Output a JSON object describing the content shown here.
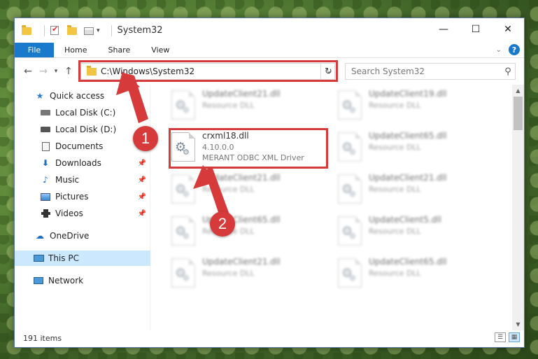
{
  "title_bar": {
    "title": "System32",
    "minimize": "—",
    "maximize": "☐",
    "close": "✕"
  },
  "ribbon": {
    "tabs": [
      "File",
      "Home",
      "Share",
      "View"
    ],
    "help": "?"
  },
  "address": {
    "path": "C:\\Windows\\System32",
    "search_placeholder": "Search System32"
  },
  "sidebar": {
    "items": [
      {
        "label": "Quick access",
        "icon": "star-icon",
        "pinned": false
      },
      {
        "label": "Local Disk (C:)",
        "icon": "drive-icon",
        "pinned": true
      },
      {
        "label": "Local Disk (D:)",
        "icon": "drive-icon",
        "pinned": false
      },
      {
        "label": "Documents",
        "icon": "documents-icon",
        "pinned": true
      },
      {
        "label": "Downloads",
        "icon": "download-icon",
        "pinned": true
      },
      {
        "label": "Music",
        "icon": "music-icon",
        "pinned": true
      },
      {
        "label": "Pictures",
        "icon": "pictures-icon",
        "pinned": true
      },
      {
        "label": "Videos",
        "icon": "videos-icon",
        "pinned": true
      },
      {
        "label": "OneDrive",
        "icon": "cloud-icon",
        "pinned": false
      },
      {
        "label": "This PC",
        "icon": "computer-icon",
        "pinned": false,
        "selected": true
      },
      {
        "label": "Network",
        "icon": "network-icon",
        "pinned": false
      }
    ]
  },
  "files": [
    {
      "name": "UpdateClient21.dll",
      "sub": "Resource DLL"
    },
    {
      "name": "UpdateClient19.dll",
      "sub": "Resource DLL"
    },
    {
      "name": "crxml18.dll",
      "sub": "4.10.0.0",
      "sub2": "MERANT ODBC XML Driver",
      "focused": true
    },
    {
      "name": "UpdateClient65.dll",
      "sub": "Resource DLL"
    },
    {
      "name": "UpdateClient21.dll",
      "sub": "Resource DLL"
    },
    {
      "name": "UpdateClient21.dll",
      "sub": "Resource DLL"
    },
    {
      "name": "UpdateClient65.dll",
      "sub": "Resource DLL"
    },
    {
      "name": "UpdateClient5.dll",
      "sub": "Resource DLL"
    },
    {
      "name": "UpdateClient21.dll",
      "sub": "Resource DLL"
    },
    {
      "name": "UpdateClient65.dll",
      "sub": "Resource DLL"
    }
  ],
  "status": {
    "count": "191 items"
  },
  "annotations": {
    "step1": "1",
    "step2": "2",
    "color": "#d63a3a"
  },
  "colors": {
    "accent": "#1979ca",
    "selection": "#cce8ff"
  }
}
